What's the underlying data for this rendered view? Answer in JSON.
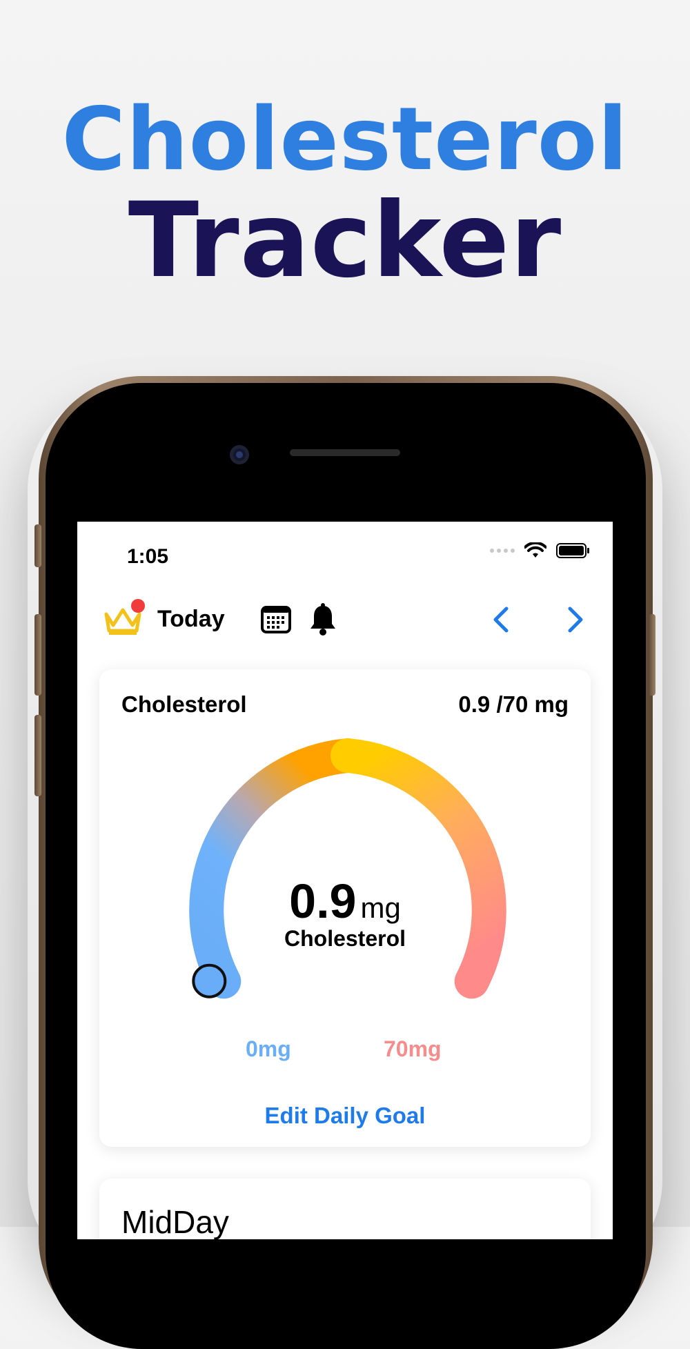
{
  "headline": {
    "line1": "Cholesterol",
    "line2": "Tracker",
    "line1_color": "#2e7fe0",
    "line2_color": "#1a1356"
  },
  "status_bar": {
    "time": "1:05",
    "icons": [
      "signal-dots-icon",
      "wifi-icon",
      "battery-icon"
    ]
  },
  "nav": {
    "premium_icon": "crown-icon",
    "title": "Today",
    "calendar_icon": "calendar-icon",
    "bell_icon": "bell-icon",
    "prev_icon": "chevron-left-icon",
    "next_icon": "chevron-right-icon",
    "accent_color": "#1f7bea"
  },
  "summary_card": {
    "title": "Cholesterol",
    "progress_text": "0.9 /70 mg",
    "current_value": "0.9",
    "unit": "mg",
    "center_label": "Cholesterol",
    "min_label": "0mg",
    "max_label": "70mg",
    "progress_fraction": 0.013,
    "edit_goal_label": "Edit Daily Goal"
  },
  "meal_card": {
    "title": "MidDay"
  }
}
